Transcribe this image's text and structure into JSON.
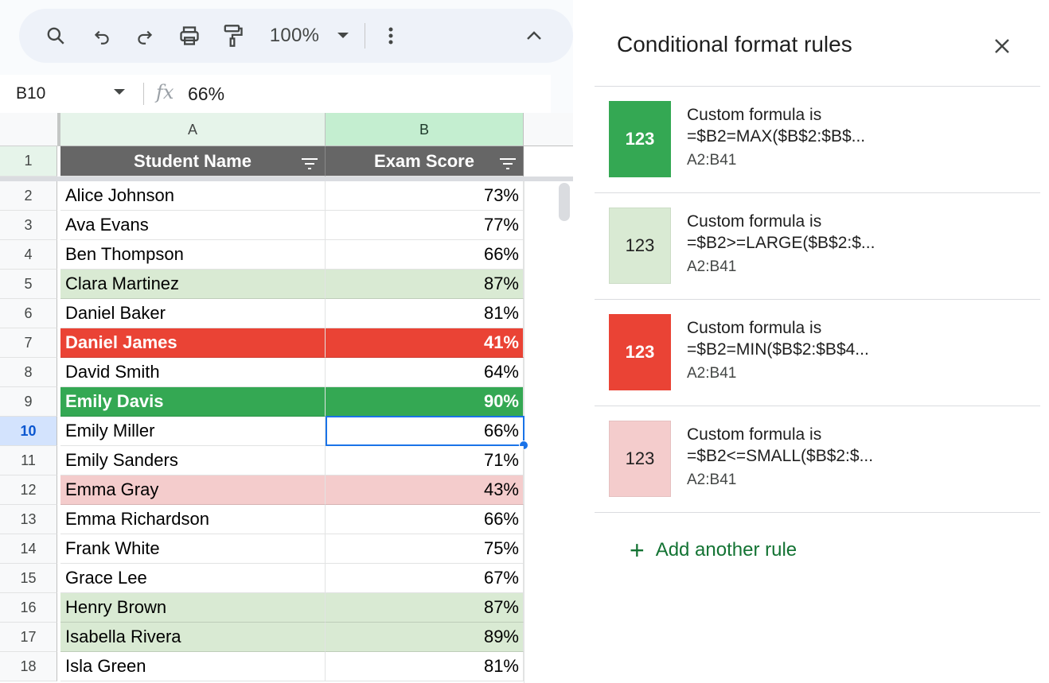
{
  "toolbar": {
    "zoom": "100%"
  },
  "formula_bar": {
    "cell_ref": "B10",
    "fx": "fx",
    "value": "66%"
  },
  "sheet": {
    "column_headers": [
      "A",
      "B"
    ],
    "header_row_number": "1",
    "header": {
      "name": "Student Name",
      "score": "Exam Score"
    },
    "rows": [
      {
        "num": "2",
        "name": "Alice Johnson",
        "score": "73%",
        "style": "none"
      },
      {
        "num": "3",
        "name": "Ava Evans",
        "score": "77%",
        "style": "none"
      },
      {
        "num": "4",
        "name": "Ben Thompson",
        "score": "66%",
        "style": "none"
      },
      {
        "num": "5",
        "name": "Clara Martinez",
        "score": "87%",
        "style": "light-green"
      },
      {
        "num": "6",
        "name": "Daniel Baker",
        "score": "81%",
        "style": "none"
      },
      {
        "num": "7",
        "name": "Daniel James",
        "score": "41%",
        "style": "red"
      },
      {
        "num": "8",
        "name": "David Smith",
        "score": "64%",
        "style": "none"
      },
      {
        "num": "9",
        "name": "Emily Davis",
        "score": "90%",
        "style": "green"
      },
      {
        "num": "10",
        "name": "Emily Miller",
        "score": "66%",
        "style": "none"
      },
      {
        "num": "11",
        "name": "Emily Sanders",
        "score": "71%",
        "style": "none"
      },
      {
        "num": "12",
        "name": "Emma Gray",
        "score": "43%",
        "style": "light-red"
      },
      {
        "num": "13",
        "name": "Emma Richardson",
        "score": "66%",
        "style": "none"
      },
      {
        "num": "14",
        "name": "Frank White",
        "score": "75%",
        "style": "none"
      },
      {
        "num": "15",
        "name": "Grace Lee",
        "score": "67%",
        "style": "none"
      },
      {
        "num": "16",
        "name": "Henry Brown",
        "score": "87%",
        "style": "light-green"
      },
      {
        "num": "17",
        "name": "Isabella Rivera",
        "score": "89%",
        "style": "light-green"
      },
      {
        "num": "18",
        "name": "Isla Green",
        "score": "81%",
        "style": "none"
      }
    ],
    "selected_row": "10",
    "selected_column": "B"
  },
  "panel": {
    "title": "Conditional format rules",
    "rules": [
      {
        "swatch_text": "123",
        "condition": "Custom formula is",
        "formula": "=$B2=MAX($B$2:$B$...",
        "range": "A2:B41",
        "bg": "#34a853",
        "fg": "#ffffff",
        "bold": true
      },
      {
        "swatch_text": "123",
        "condition": "Custom formula is",
        "formula": "=$B2>=LARGE($B$2:$...",
        "range": "A2:B41",
        "bg": "#d9ead3",
        "fg": "#1f1f1f",
        "bold": false
      },
      {
        "swatch_text": "123",
        "condition": "Custom formula is",
        "formula": "=$B2=MIN($B$2:$B$4...",
        "range": "A2:B41",
        "bg": "#ea4335",
        "fg": "#ffffff",
        "bold": true
      },
      {
        "swatch_text": "123",
        "condition": "Custom formula is",
        "formula": "=$B2<=SMALL($B$2:$...",
        "range": "A2:B41",
        "bg": "#f4cccc",
        "fg": "#1f1f1f",
        "bold": false
      }
    ],
    "add_rule": "Add another rule",
    "add_rule_icon": "+"
  },
  "colors": {
    "green": "#34a853",
    "light_green": "#d9ead3",
    "red": "#ea4335",
    "light_red": "#f4cccc",
    "header_gray": "#666666",
    "selection_blue": "#1a73e8",
    "accent_green": "#137333"
  },
  "icons": [
    "search-icon",
    "undo-icon",
    "redo-icon",
    "print-icon",
    "paint-format-icon",
    "chevron-down-icon",
    "more-vert-icon",
    "chevron-up-icon",
    "close-icon",
    "filter-icon",
    "fx-icon",
    "plus-icon"
  ]
}
